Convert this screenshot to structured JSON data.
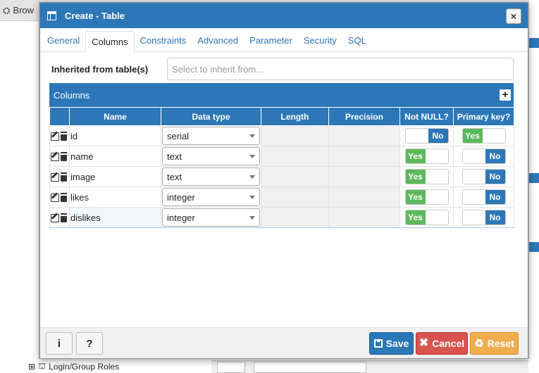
{
  "background": {
    "browser_label": "Brow",
    "tree_item": "Login/Group Roles"
  },
  "dialog": {
    "title": "Create - Table",
    "close_label": "×",
    "tabs": [
      "General",
      "Columns",
      "Constraints",
      "Advanced",
      "Parameter",
      "Security",
      "SQL"
    ],
    "active_tab": "Columns",
    "inherit_label": "Inherited from table(s)",
    "inherit_placeholder": "Select to inherit from...",
    "grid_title": "Columns",
    "add_label": "+",
    "headers": [
      "Name",
      "Data type",
      "Length",
      "Precision",
      "Not NULL?",
      "Primary key?"
    ],
    "rows": [
      {
        "name": "id",
        "data_type": "serial",
        "not_null": "No",
        "primary_key": "Yes"
      },
      {
        "name": "name",
        "data_type": "text",
        "not_null": "Yes",
        "primary_key": "No"
      },
      {
        "name": "image",
        "data_type": "text",
        "not_null": "Yes",
        "primary_key": "No"
      },
      {
        "name": "likes",
        "data_type": "integer",
        "not_null": "Yes",
        "primary_key": "No"
      },
      {
        "name": "dislikes",
        "data_type": "integer",
        "not_null": "Yes",
        "primary_key": "No"
      }
    ],
    "footer": {
      "info_label": "i",
      "help_label": "?",
      "save_label": "Save",
      "cancel_label": "Cancel",
      "reset_label": "Reset"
    }
  },
  "colors": {
    "primary": "#2c77b7",
    "success": "#5cb85c",
    "danger": "#d9534f",
    "warning": "#f0ad4e"
  }
}
